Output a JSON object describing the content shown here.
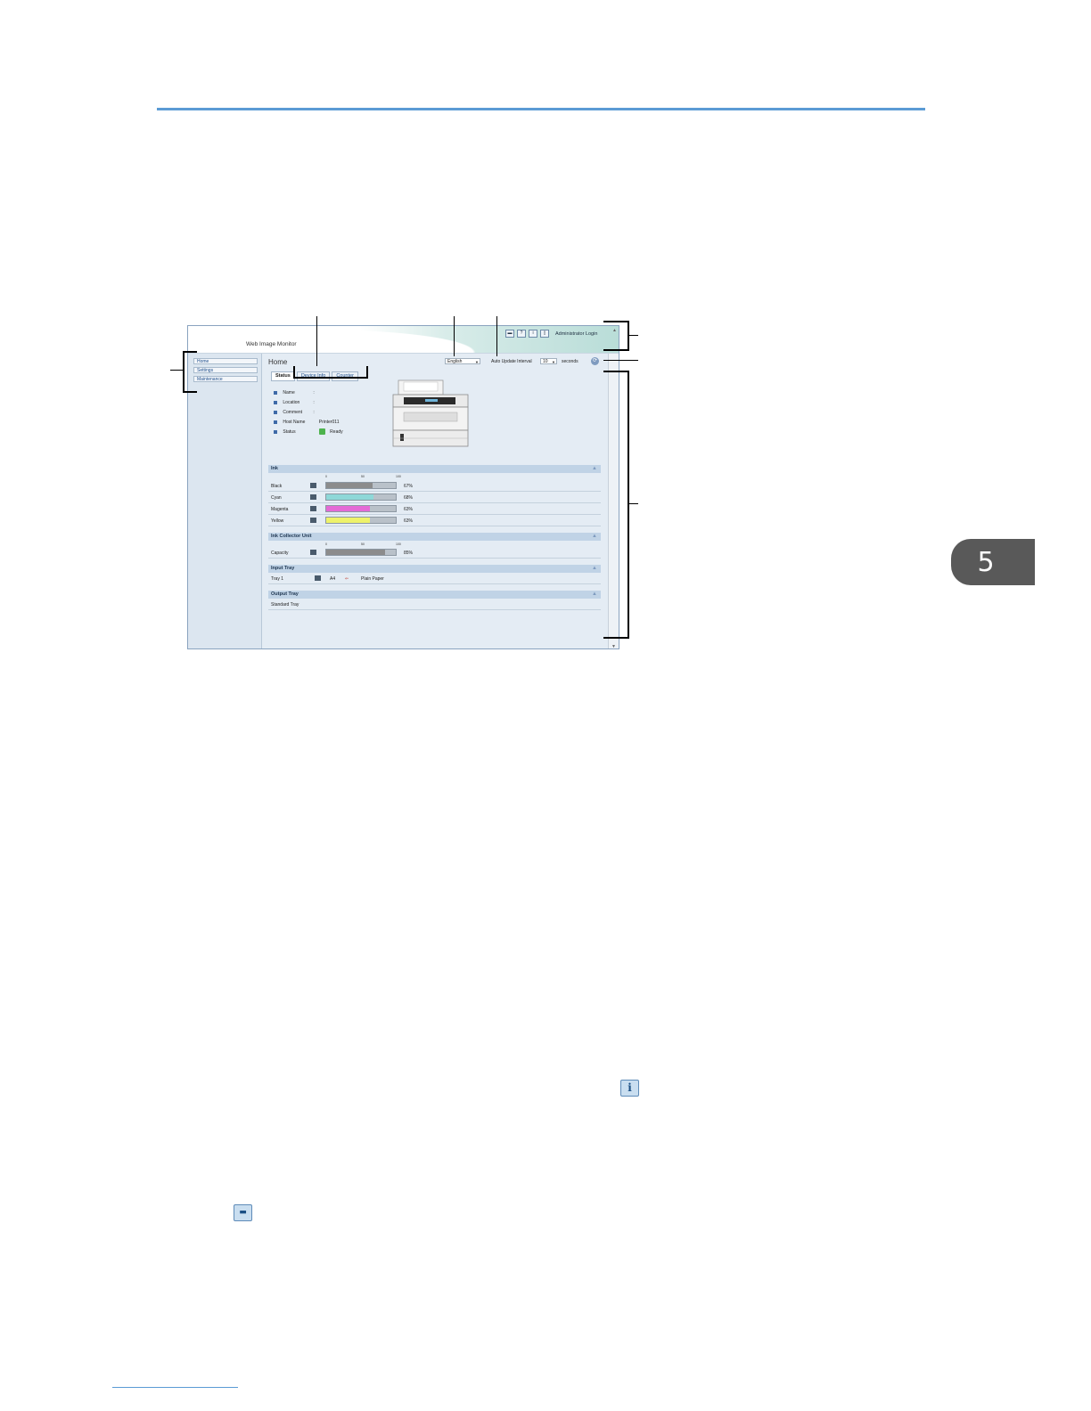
{
  "chapter": "5",
  "window": {
    "app_title": "Web Image Monitor",
    "header_icons": [
      "printer-icon",
      "help-icon",
      "info-icon",
      "trash-icon"
    ],
    "admin_login": "Administrator Login",
    "nav": [
      "Home",
      "Settings",
      "Maintenance"
    ],
    "page_title": "Home",
    "language": "English",
    "interval_label": "Auto Update Interval",
    "interval_value": "10",
    "seconds_label": "seconds",
    "tabs": [
      "Status",
      "Device Info",
      "Counter"
    ],
    "status_info": [
      {
        "label": "Name",
        "value": ""
      },
      {
        "label": "Location",
        "value": ""
      },
      {
        "label": "Comment",
        "value": ""
      },
      {
        "label": "Host Name",
        "value": "Printer011"
      },
      {
        "label": "Status",
        "value": "Ready"
      }
    ],
    "ink_section": "Ink",
    "scale": [
      "0",
      "50",
      "100"
    ],
    "ink": [
      {
        "name": "Black",
        "percent": "67%",
        "level": 0.67,
        "color": "#8c8c8c"
      },
      {
        "name": "Cyan",
        "percent": "68%",
        "level": 0.68,
        "color": "#8fd8d8"
      },
      {
        "name": "Magenta",
        "percent": "63%",
        "level": 0.63,
        "color": "#e46ad6"
      },
      {
        "name": "Yellow",
        "percent": "63%",
        "level": 0.63,
        "color": "#eef26a"
      }
    ],
    "collector_section": "Ink Collector Unit",
    "collector": {
      "name": "Capacity",
      "percent": "85%",
      "level": 0.85,
      "color": "#8c8c8c"
    },
    "input_section": "Input Tray",
    "input_tray": {
      "name": "Tray 1",
      "size": "A4",
      "type": "Plain Paper"
    },
    "output_section": "Output Tray",
    "output_tray": {
      "name": "Standard Tray"
    }
  }
}
